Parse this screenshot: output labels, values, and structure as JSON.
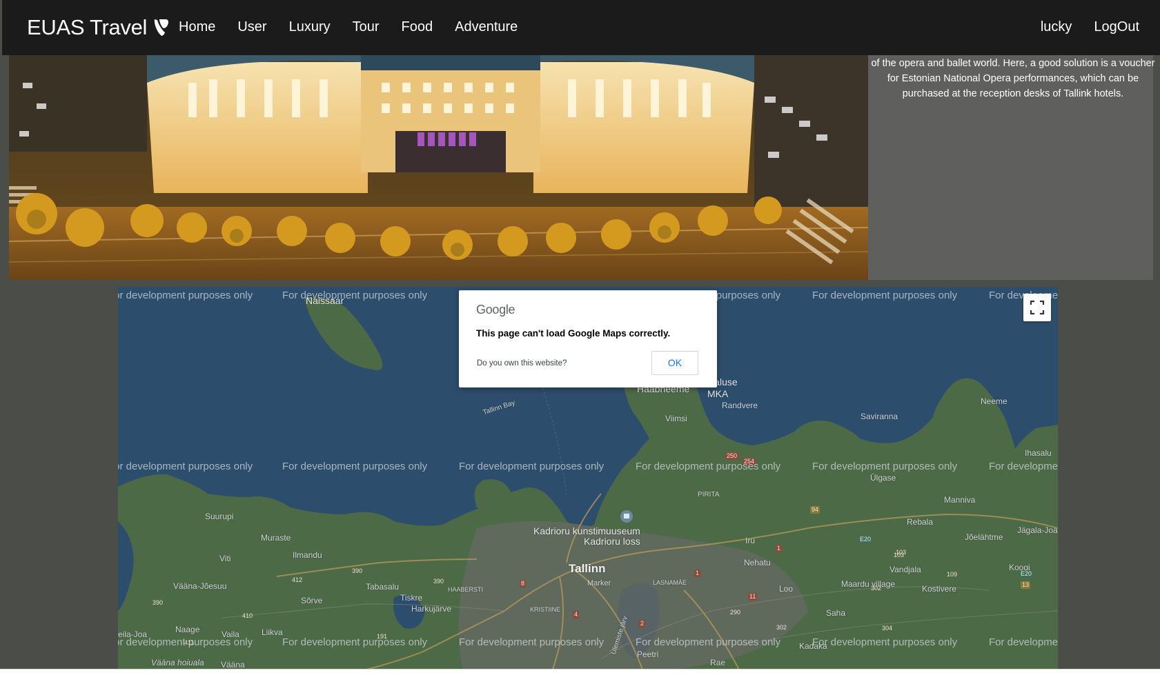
{
  "navbar": {
    "brand": "EUAS Travel",
    "links": [
      "Home",
      "User",
      "Luxury",
      "Tour",
      "Food",
      "Adventure"
    ],
    "user": "lucky",
    "logout": "LogOut"
  },
  "hero": {
    "text": "of the opera and ballet world. Here, a good solution is a voucher for Estonian National Opera performances, which can be purchased at the reception desks of Tallink hotels."
  },
  "map": {
    "watermark": "For development purposes only",
    "places": {
      "naissaar": "Naissaar",
      "haabneeme": "Haabneeme",
      "maealuse": "Mäealuse",
      "mka": "MKA",
      "randvere": "Randvere",
      "viimsi": "Viimsi",
      "tallinn_bay": "Tallinn Bay",
      "saviranna": "Saviranna",
      "neeme": "Neeme",
      "ihasalu": "Ihasalu",
      "ulgase": "Ülgase",
      "manniva": "Manniva",
      "rebala": "Rebala",
      "joelahtme": "Jõelähtme",
      "jagala_joa": "Jägala-Joa",
      "pirita": "PIRITA",
      "kadriorg_museum": "Kadrioru kunstimuuseum",
      "kadriorg_palace": "Kadrioru loss",
      "iru": "Iru",
      "nehatu": "Nehatu",
      "vandjala": "Vandjala",
      "kostivere": "Kostivere",
      "maardu": "Maardu village",
      "koogi": "Koogi",
      "suurupi": "Suurupi",
      "muraste": "Muraste",
      "ilmandu": "Ilmandu",
      "viti": "Viti",
      "tallinn": "Tallinn",
      "marker": "Marker",
      "tabasalu": "Tabasalu",
      "haabersti": "HAABERSTI",
      "lasnamae": "LASNAMÄE",
      "vaana_josuu": "Vääna-Jõesuu",
      "tiskre": "Tiskre",
      "harkujarve": "Harkujärve",
      "sorve": "Sõrve",
      "kristiine": "KRISTIINE",
      "loo": "Loo",
      "saha": "Saha",
      "naage": "Naage",
      "vaila": "Vaila",
      "liikva": "Liikva",
      "peetri": "Peetri",
      "kadaka": "Kadaka",
      "vaana_hoiuala": "Vääna hoiuala",
      "vaana": "Vääna",
      "rae": "Rae",
      "ulemiste": "Ülemiste järv",
      "keila_joa": "eila-Joa"
    },
    "roads": [
      "250",
      "254",
      "94",
      "E20",
      "103",
      "109",
      "E20",
      "13",
      "390",
      "412",
      "390",
      "410",
      "390",
      "191",
      "411",
      "8",
      "4",
      "2",
      "1",
      "11",
      "290",
      "302",
      "304",
      "302",
      "103",
      "1"
    ]
  },
  "dialog": {
    "logo": "Google",
    "message": "This page can't load Google Maps correctly.",
    "own": "Do you own this website?",
    "ok": "OK"
  },
  "colors": {
    "navbar": "#1b1b1b",
    "page_bg": "#4b4d48",
    "water": "#2d4d6c",
    "land": "#4d6a47",
    "ok_blue": "#1a73e8"
  },
  "icons": [
    "typo3-logo-icon",
    "fullscreen-icon"
  ]
}
